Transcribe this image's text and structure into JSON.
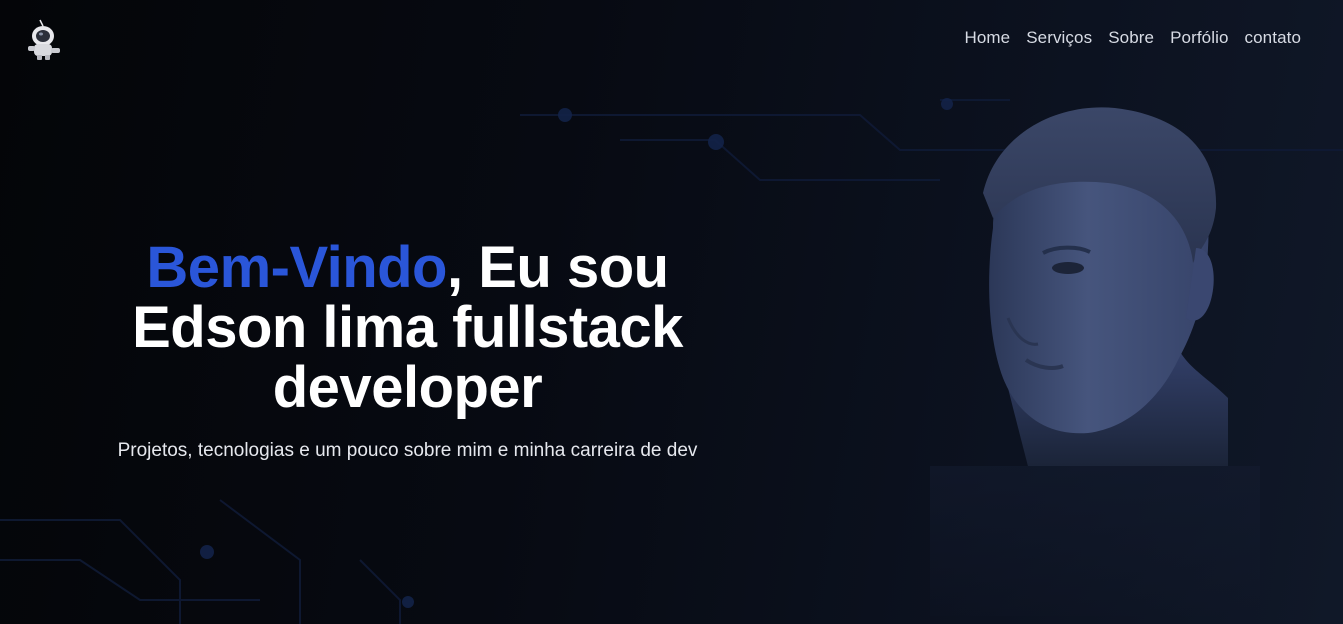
{
  "nav": {
    "items": [
      {
        "label": "Home"
      },
      {
        "label": "Serviços"
      },
      {
        "label": "Sobre"
      },
      {
        "label": "Porfólio"
      },
      {
        "label": "contato"
      }
    ]
  },
  "hero": {
    "title_accent": "Bem-Vindo",
    "title_rest_line1": ", Eu sou",
    "title_line2": "Edson lima fullstack",
    "title_line3": "developer",
    "subtitle": "Projetos, tecnologias e um pouco sobre mim e minha carreira de dev"
  },
  "icons": {
    "logo": "astronaut-icon"
  },
  "colors": {
    "accent": "#2a56d9",
    "background": "#070a12",
    "nav_text": "#d7dbe4"
  }
}
